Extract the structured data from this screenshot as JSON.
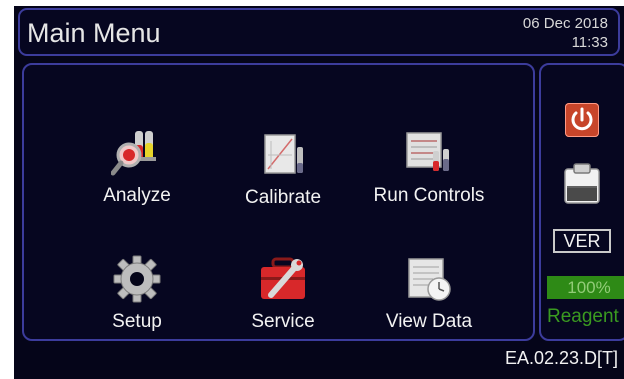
{
  "header": {
    "title": "Main Menu",
    "date": "06 Dec 2018",
    "time": "11:33"
  },
  "menu": {
    "items": [
      {
        "label": "Analyze",
        "icon": "analyze-icon"
      },
      {
        "label": "Calibrate",
        "icon": "calibrate-icon"
      },
      {
        "label": "Run Controls",
        "icon": "run-controls-icon"
      },
      {
        "label": "Setup",
        "icon": "gear-icon"
      },
      {
        "label": "Service",
        "icon": "toolbox-icon"
      },
      {
        "label": "View Data",
        "icon": "view-data-icon"
      }
    ]
  },
  "side": {
    "power_icon": "power-icon",
    "clipboard_icon": "clipboard-icon",
    "ver_label": "VER",
    "reagent_level": "100%",
    "reagent_label": "Reagent"
  },
  "footer": {
    "version": "EA.02.23.D[T]"
  },
  "colors": {
    "background": "#050519",
    "panel_border": "#3c3c9c",
    "power": "#c7452a",
    "reagent": "#2e8a16"
  }
}
